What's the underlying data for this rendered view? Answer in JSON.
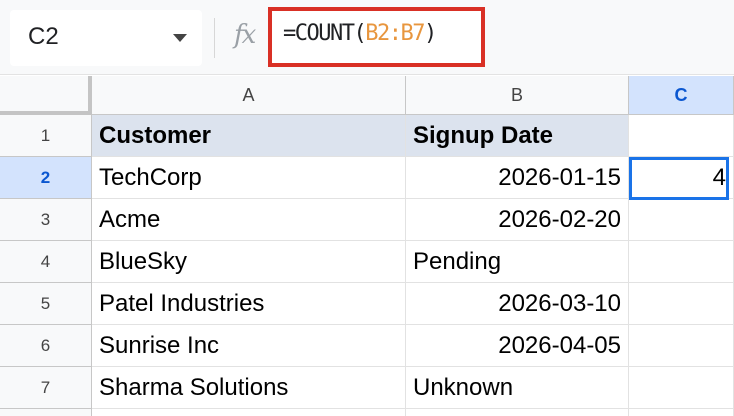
{
  "name_box": {
    "value": "C2"
  },
  "formula_bar": {
    "fx_label": "fx",
    "prefix": "=COUNT(",
    "range": "B2:B7",
    "suffix": ")"
  },
  "columns": [
    "A",
    "B",
    "C"
  ],
  "rows": [
    "1",
    "2",
    "3",
    "4",
    "5",
    "6",
    "7"
  ],
  "cells": [
    [
      "Customer",
      "Signup Date",
      ""
    ],
    [
      "TechCorp",
      "2026-01-15",
      "4"
    ],
    [
      "Acme",
      "2026-02-20",
      ""
    ],
    [
      "BlueSky",
      "Pending",
      ""
    ],
    [
      "Patel Industries",
      "2026-03-10",
      ""
    ],
    [
      "Sunrise Inc",
      "2026-04-05",
      ""
    ],
    [
      "Sharma Solutions",
      "Unknown",
      ""
    ]
  ],
  "selection": {
    "active_cell": "C2",
    "column": "C",
    "row": "2"
  },
  "colors": {
    "accent": "#1a73e8",
    "header_fill": "#dce3ee",
    "highlight_border": "#d93025",
    "range_ref": "#e8963e"
  }
}
